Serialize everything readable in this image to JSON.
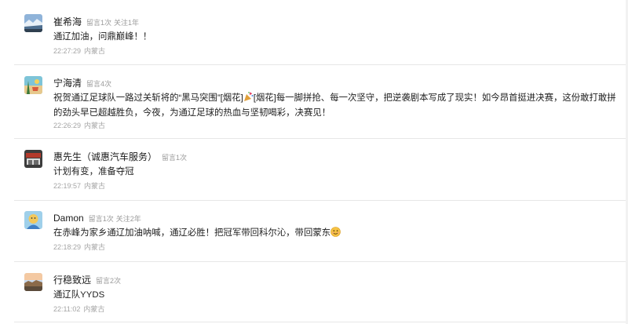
{
  "comments": [
    {
      "user": "崔希海",
      "meta1": "留言1次",
      "meta2": "关注1年",
      "avatar_icon": "snow-landscape-avatar",
      "text": "通辽加油，问鼎巅峰！！",
      "time": "22:27:29",
      "location": "内蒙古"
    },
    {
      "user": "宁海清",
      "meta1": "留言4次",
      "meta2": "",
      "avatar_icon": "beach-avatar",
      "text_a": "祝贺通辽足球队一路过关斩将的“黑马突围”[烟花]",
      "emoji_a": "party-popper-icon",
      "text_b": "[烟花]每一脚拼抢、每一次坚守，把逆袭剧本写成了现实！如今昂首挺进决赛，这份敢打敢拼的劲头早已超越胜负，今夜，为通辽足球的热血与坚韧喝彩，决赛见！",
      "time": "22:26:29",
      "location": "内蒙古"
    },
    {
      "user": "惠先生（诚惠汽车服务）",
      "meta1": "留言1次",
      "meta2": "",
      "avatar_icon": "car-service-avatar",
      "text": "计划有变，准备夺冠",
      "time": "22:19:57",
      "location": "内蒙古"
    },
    {
      "user": "Damon",
      "meta1": "留言1次",
      "meta2": "关注2年",
      "avatar_icon": "cartoon-avatar",
      "text": "在赤峰为家乡通辽加油呐喊，通辽必胜！把冠军带回科尔沁，带回蒙东",
      "emoji": "smile-emoji-icon",
      "time": "22:18:29",
      "location": "内蒙古"
    },
    {
      "user": "行稳致远",
      "meta1": "留言2次",
      "meta2": "",
      "avatar_icon": "sunset-avatar",
      "text": "通辽队YYDS",
      "time": "22:11:02",
      "location": "内蒙古"
    }
  ]
}
